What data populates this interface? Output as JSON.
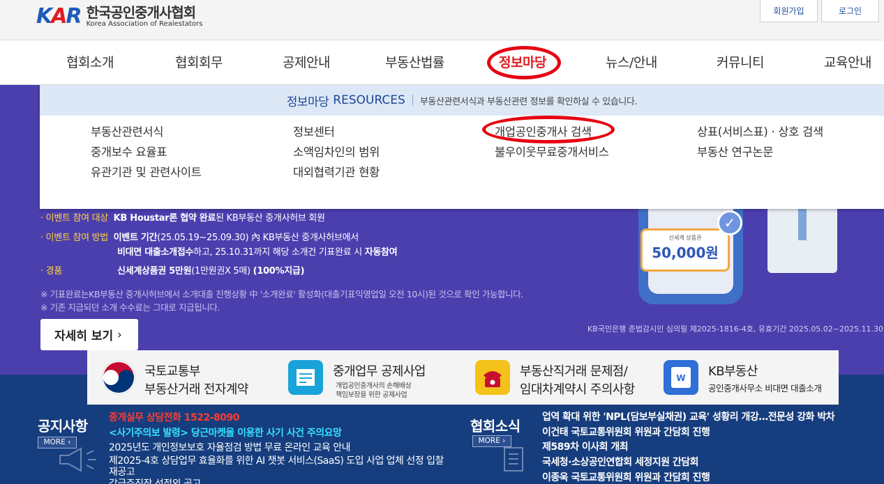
{
  "header": {
    "logo_mark_k": "K",
    "logo_mark_a": "A",
    "logo_mark_r": "R",
    "org_name_ko": "한국공인중개사협회",
    "org_name_en": "Korea Association of Realestators",
    "signup_label": "회원가입",
    "login_label": "로그인"
  },
  "gnb": {
    "items": [
      "협회소개",
      "협회회무",
      "공제안내",
      "부동산법률",
      "정보마당",
      "뉴스/안내",
      "커뮤니티",
      "교육안내"
    ],
    "active_index": 4
  },
  "dropdown": {
    "title": "정보마당",
    "title_en": "RESOURCES",
    "description": "부동산관련서식과 부동산관련 정보를 확인하실 수 있습니다.",
    "items": [
      "부동산관련서식",
      "중개보수 요율표",
      "유관기관 및 관련사이트",
      "정보센터",
      "소액임차인의 범위",
      "대외협력기관 현황",
      "개업공인중개사 검색",
      "불우이웃무료중개서비스",
      "상표(서비스표) · 상호 검색",
      "부동산 연구논문"
    ]
  },
  "hero": {
    "row1_label": "이벤트 참여 대상",
    "row1_bold": "KB Houstar론 협약 완료",
    "row1_text": "된 KB부동산 중개사허브 회원",
    "row2_label": "이벤트 참여 방법",
    "row2_bold": "이벤트 기간",
    "row2_text": "(25.05.19~25.09.30) 內 KB부동산 중개사허브에서",
    "row2b_bold": "비대면 대출소개접수",
    "row2b_text": "하고, 25.10.31까지 해당 소개건 기표완료 시 ",
    "row2b_bold2": "자동참여",
    "row3_label": "경품",
    "row3_bold": "신세계상품권 5만원",
    "row3_text": "(1만원권X 5매) ",
    "row3_bold2": "(100%지급)",
    "note1": "※ 기표완료는KB부동산 중개사허브에서 소개대출 진행상황 中 '소개완료' 활성화(대출기표익영업일 오전 10시)된 것으로 확인 가능합니다.",
    "note2": "※ 기존 지급되던 소개 수수료는 그대로 지급됩니다.",
    "legal": "KB국민은행 준법감시인 심의필 제2025-1816-4호, 유효기간 2025.05.02~2025.11.30",
    "detail_label": "자세히 보기",
    "detail_arrow": "›",
    "voucher_small": "신세계 상품권",
    "voucher_value": "50,000원",
    "check_icon": "✓"
  },
  "banners": [
    {
      "line1": "국토교통부",
      "line2": "부동산거래 전자계약",
      "icon": "korea-gov-icon",
      "color": "#ffffff"
    },
    {
      "line1": "중개업무 공제사업",
      "sub1": "개업공인중개사의 손해배상",
      "sub2": "책임보장을 위한 공제사업",
      "icon": "document-icon",
      "color": "#1aa3d9"
    },
    {
      "line1": "부동산직거래 문제점/",
      "line2": "임대차계약시 주의사항",
      "icon": "phone-icon",
      "color": "#f4c21a"
    },
    {
      "line1": "KB부동산",
      "sub": "공인중개사무소 비대면 대출소개",
      "icon": "kb-icon",
      "color": "#2f6fd6"
    }
  ],
  "notice": {
    "title": "공지사항",
    "more": "MORE ›",
    "items": [
      "중개실무 상담전화 1522-8090",
      "<사기주의보 발령> 당근마켓을 이용한 사기 사건 주의요망",
      "2025년도 개인정보보호 자율점검 방법 무료 온라인 교육 안내",
      "제2025-4호 상담업무 효율화를 위한 AI 챗봇 서비스(SaaS) 도입 사업 업체 선정 입찰",
      "재공고",
      "감급주진장 선정외 공고"
    ]
  },
  "assoc": {
    "title": "협회소식",
    "more": "MORE ›",
    "items": [
      "업역 확대 위한 'NPL(담보부실채권) 교육' 성황리 개강…전문성 강화 박차",
      "이건태 국토교통위원회 위원과 간담회 진행",
      "제589차 이사회 개최",
      "국세청·소상공인연합회 세정지원 간담회",
      "이종욱 국토교통위원회 위원과 간담회 진행"
    ]
  }
}
